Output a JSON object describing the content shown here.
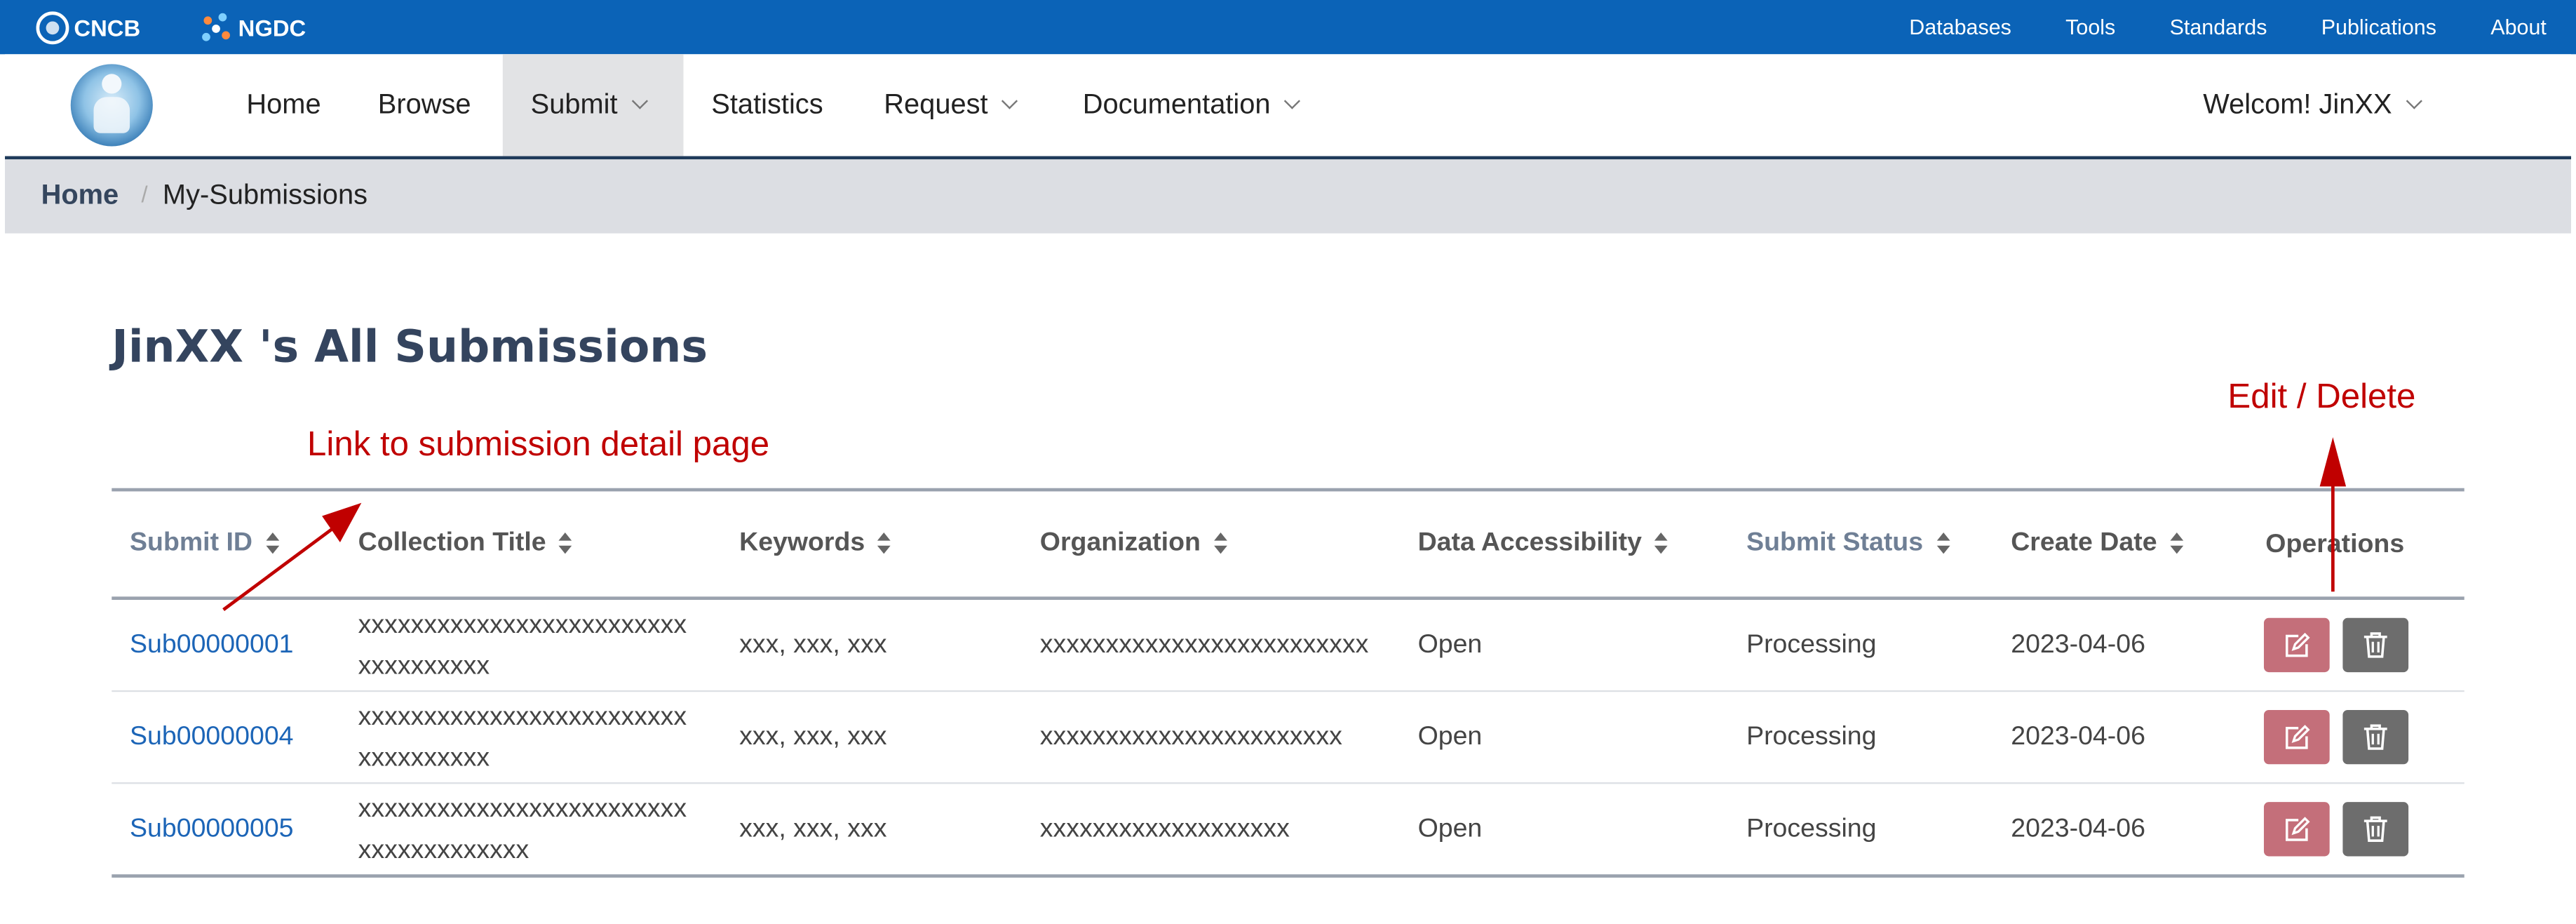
{
  "topbar": {
    "brand1": "CNCB",
    "brand2": "NGDC",
    "links": [
      "Databases",
      "Tools",
      "Standards",
      "Publications",
      "About"
    ]
  },
  "nav": {
    "items": [
      {
        "label": "Home"
      },
      {
        "label": "Browse"
      },
      {
        "label": "Submit"
      },
      {
        "label": "Statistics"
      },
      {
        "label": "Request"
      },
      {
        "label": "Documentation"
      }
    ],
    "user": "Welcom! JinXX"
  },
  "breadcrumb": {
    "home": "Home",
    "separator": "/",
    "current": "My-Submissions"
  },
  "page": {
    "title": "JinXX 's All Submissions"
  },
  "annotations": {
    "link": "Link to submission detail page",
    "ops": "Edit / Delete"
  },
  "table": {
    "headers": [
      "Submit ID",
      "Collection Title",
      "Keywords",
      "Organization",
      "Data Accessibility",
      "Submit Status",
      "Create Date",
      "Operations"
    ],
    "rows": [
      {
        "id": "Sub00000001",
        "title1": "xxxxxxxxxxxxxxxxxxxxxxxxx",
        "title2": "xxxxxxxxxx",
        "keywords": "xxx, xxx, xxx",
        "org": "xxxxxxxxxxxxxxxxxxxxxxxxx",
        "access": "Open",
        "status": "Processing",
        "date": "2023-04-06"
      },
      {
        "id": "Sub00000004",
        "title1": "xxxxxxxxxxxxxxxxxxxxxxxxx",
        "title2": "xxxxxxxxxx",
        "keywords": "xxx, xxx, xxx",
        "org": "xxxxxxxxxxxxxxxxxxxxxxx",
        "access": "Open",
        "status": "Processing",
        "date": "2023-04-06"
      },
      {
        "id": "Sub00000005",
        "title1": "xxxxxxxxxxxxxxxxxxxxxxxxx",
        "title2": "xxxxxxxxxxxxx",
        "keywords": "xxx, xxx, xxx",
        "org": "xxxxxxxxxxxxxxxxxxx",
        "access": "Open",
        "status": "Processing",
        "date": "2023-04-06"
      }
    ]
  },
  "icons": {
    "edit": "edit-icon",
    "delete": "trash-icon"
  },
  "colors": {
    "topbar": "#0b63b7",
    "link": "#1c65b7",
    "annotation": "#c00000",
    "edit_button": "#c46f7a",
    "delete_button": "#6d6d6d",
    "title": "#34445e"
  }
}
